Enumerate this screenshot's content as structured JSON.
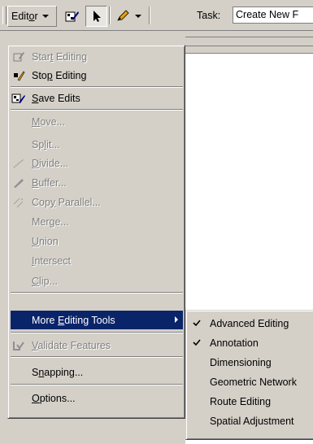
{
  "toolbar": {
    "editor_menu": {
      "before": "Edit",
      "mnemonic": "o",
      "after": "r"
    },
    "task_label": "Task:",
    "task_value": "Create New F"
  },
  "menu": {
    "items": [
      {
        "before": "Star",
        "mnemonic": "t",
        "after": " Editing",
        "enabled": false,
        "icon": "start-editing-icon"
      },
      {
        "before": "Sto",
        "mnemonic": "p",
        "after": " Editing",
        "enabled": true,
        "icon": "stop-editing-icon"
      },
      {
        "before": "",
        "mnemonic": "S",
        "after": "ave Edits",
        "enabled": true,
        "icon": "save-edits-icon"
      },
      {
        "before": "",
        "mnemonic": "M",
        "after": "ove...",
        "enabled": false,
        "icon": ""
      },
      {
        "before": "Sp",
        "mnemonic": "l",
        "after": "it...",
        "enabled": false,
        "icon": ""
      },
      {
        "before": "",
        "mnemonic": "D",
        "after": "ivide...",
        "enabled": false,
        "icon": "divide-icon"
      },
      {
        "before": "",
        "mnemonic": "B",
        "after": "uffer...",
        "enabled": false,
        "icon": "buffer-icon"
      },
      {
        "before": "Cop",
        "mnemonic": "y",
        "after": " Parallel...",
        "enabled": false,
        "icon": "copy-parallel-icon"
      },
      {
        "before": "Mer",
        "mnemonic": "g",
        "after": "e...",
        "enabled": false,
        "icon": ""
      },
      {
        "before": "",
        "mnemonic": "U",
        "after": "nion",
        "enabled": false,
        "icon": ""
      },
      {
        "before": "",
        "mnemonic": "I",
        "after": "ntersect",
        "enabled": false,
        "icon": ""
      },
      {
        "before": "",
        "mnemonic": "C",
        "after": "lip...",
        "enabled": false,
        "icon": ""
      },
      {
        "before": "More ",
        "mnemonic": "E",
        "after": "diting Tools",
        "enabled": true,
        "selected": true,
        "submenu": true,
        "icon": ""
      },
      {
        "before": "",
        "mnemonic": "V",
        "after": "alidate Features",
        "enabled": false,
        "icon": "validate-features-icon"
      },
      {
        "before": "S",
        "mnemonic": "n",
        "after": "apping...",
        "enabled": true,
        "icon": ""
      },
      {
        "before": "",
        "mnemonic": "O",
        "after": "ptions...",
        "enabled": true,
        "icon": ""
      }
    ]
  },
  "submenu": {
    "items": [
      {
        "label": "Advanced Editing",
        "checked": true
      },
      {
        "label": "Annotation",
        "checked": true
      },
      {
        "label": "Dimensioning",
        "checked": false
      },
      {
        "label": "Geometric Network",
        "checked": false
      },
      {
        "label": "Route Editing",
        "checked": false
      },
      {
        "label": "Spatial Adjustment",
        "checked": false
      }
    ]
  },
  "colors": {
    "face": "#d4d0c8",
    "highlight": "#0a246a",
    "disabled_text": "#808080"
  }
}
